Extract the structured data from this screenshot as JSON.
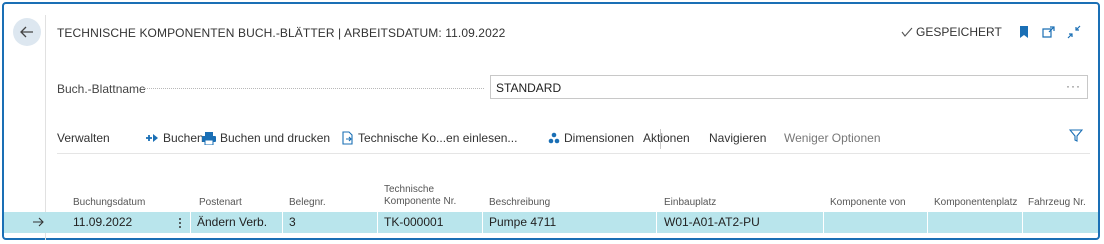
{
  "header": {
    "title": "TECHNISCHE KOMPONENTEN BUCH.-BLÄTTER | ARBEITSDATUM: 11.09.2022",
    "status": "GESPEICHERT"
  },
  "field": {
    "label": "Buch.-Blattname",
    "value": "STANDARD",
    "more": "···"
  },
  "actions": {
    "verwalten": "Verwalten",
    "buchen": "Buchen",
    "buchen_drucken": "Buchen und drucken",
    "einlesen": "Technische Ko...en einlesen...",
    "dimensionen": "Dimensionen",
    "aktionen": "Aktionen",
    "navigieren": "Navigieren",
    "weniger": "Weniger Optionen"
  },
  "columns": {
    "buchungsdatum": "Buchungsdatum",
    "postenart": "Postenart",
    "belegnr": "Belegnr.",
    "tk_line1": "Technische",
    "tk_line2": "Komponente Nr.",
    "beschreibung": "Beschreibung",
    "einbauplatz": "Einbauplatz",
    "komponente_von": "Komponente von",
    "komponentenplatz": "Komponentenplatz",
    "fahrzeug": "Fahrzeug Nr."
  },
  "rows": [
    {
      "buchungsdatum": "11.09.2022",
      "postenart": "Ändern Verb.",
      "belegnr": "3",
      "tk_nr": "TK-000001",
      "beschreibung": "Pumpe 4711",
      "einbauplatz": "W01-A01-AT2-PU",
      "komponente_von": "",
      "komponentenplatz": "",
      "fahrzeug": ""
    }
  ],
  "icons": {
    "back": "arrow-left-icon",
    "saved": "checkmark-icon",
    "bookmark": "bookmark-icon",
    "open_new": "open-in-new-window-icon",
    "collapse": "collapse-icon",
    "post": "post-icon",
    "post_print": "print-icon",
    "import": "import-document-icon",
    "dimensions": "dimensions-icon",
    "filter": "filter-icon",
    "row_marker": "arrow-right-icon",
    "row_menu": "more-vertical-icon"
  },
  "colors": {
    "accent": "#1a6fb5",
    "selected_row": "#b9e5ec",
    "back_button_bg": "#dde7f0"
  }
}
